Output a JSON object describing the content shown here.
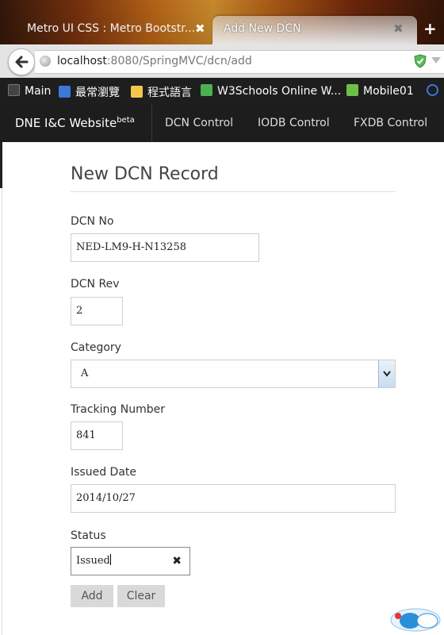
{
  "browser": {
    "tabs": [
      {
        "title": "Metro UI CSS : Metro Bootstr...",
        "active": false
      },
      {
        "title": "Add New DCN",
        "active": true
      }
    ],
    "close_glyph": "✖",
    "new_tab_glyph": "+",
    "url_host": "localhost",
    "url_rest": ":8080/SpringMVC/dcn/add",
    "bookmarks": [
      {
        "label": "Main",
        "icon": "page-icon",
        "color": "#444444"
      },
      {
        "label": "最常瀏覽",
        "icon": "search-icon",
        "color": "#3b78d8"
      },
      {
        "label": "程式語言",
        "icon": "folder-icon",
        "color": "#f2c84b"
      },
      {
        "label": "W3Schools Online W...",
        "icon": "chart-icon",
        "color": "#4caf50"
      },
      {
        "label": "Mobile01",
        "icon": "mobile01-icon",
        "color": "#6cc04a"
      }
    ]
  },
  "site": {
    "brand": "DNE I&C Website",
    "brand_sup": "beta",
    "nav": [
      "DCN Control",
      "IODB Control",
      "FXDB Control"
    ]
  },
  "form": {
    "title": "New DCN Record",
    "fields": {
      "dcn_no": {
        "label": "DCN No",
        "value": "NED-LM9-H-N13258"
      },
      "dcn_rev": {
        "label": "DCN Rev",
        "value": "2"
      },
      "category": {
        "label": "Category",
        "value": "A"
      },
      "tracking_number": {
        "label": "Tracking Number",
        "value": "841"
      },
      "issued_date": {
        "label": "Issued Date",
        "value": "2014/10/27"
      },
      "status": {
        "label": "Status",
        "value": "Issued",
        "clear_glyph": "✖"
      }
    },
    "buttons": {
      "add": "Add",
      "clear": "Clear"
    }
  },
  "colors": {
    "navbar": "#1d1d1d",
    "button": "#d9d9d9"
  }
}
